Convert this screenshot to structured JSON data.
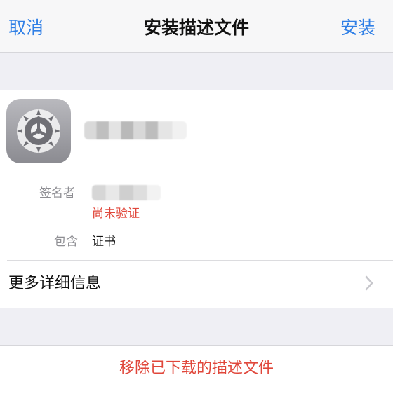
{
  "navbar": {
    "cancel": "取消",
    "title": "安装描述文件",
    "install": "安装"
  },
  "profile": {
    "signer_label": "签名者",
    "signer_status": "尚未验证",
    "contains_label": "包含",
    "contains_value": "证书"
  },
  "more_details": {
    "label": "更多详细信息"
  },
  "remove": {
    "label": "移除已下载的描述文件"
  },
  "colors": {
    "accent": "#2f7fe6",
    "danger": "#e0473b",
    "background": "#efeff4"
  },
  "icons": {
    "app": "settings-gear-icon",
    "chevron": "chevron-right-icon"
  }
}
